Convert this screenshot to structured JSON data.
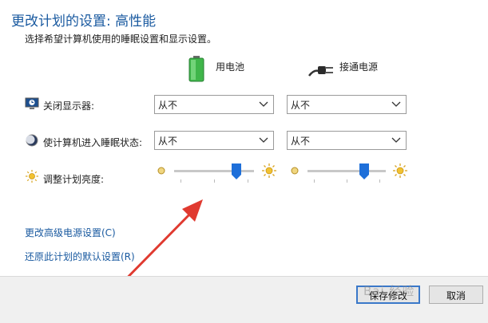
{
  "header": {
    "title": "更改计划的设置: 高性能",
    "subtitle": "选择希望计算机使用的睡眠设置和显示设置。"
  },
  "columns": {
    "battery_label": "用电池",
    "plugged_label": "接通电源",
    "battery_icon": "battery-icon",
    "plugged_icon": "power-plug-icon"
  },
  "rows": {
    "display_off": {
      "label": "关闭显示器:",
      "icon": "display-off-icon",
      "battery_value": "从不",
      "plugged_value": "从不"
    },
    "sleep": {
      "label": "使计算机进入睡眠状态:",
      "icon": "sleep-moon-icon",
      "battery_value": "从不",
      "plugged_value": "从不"
    },
    "brightness": {
      "label": "调整计划亮度:",
      "icon": "sun-icon",
      "battery_level": 0.78,
      "plugged_level": 0.72
    }
  },
  "links": {
    "advanced": "更改高级电源设置(C)",
    "restore": "还原此计划的默认设置(R)"
  },
  "buttons": {
    "save": "保存修改",
    "cancel": "取消"
  },
  "watermark": "Bai 经验",
  "colors": {
    "title": "#1a5aa0",
    "link": "#1a5aa0",
    "slider_thumb": "#1e6fd9",
    "arrow": "#e03a30"
  }
}
